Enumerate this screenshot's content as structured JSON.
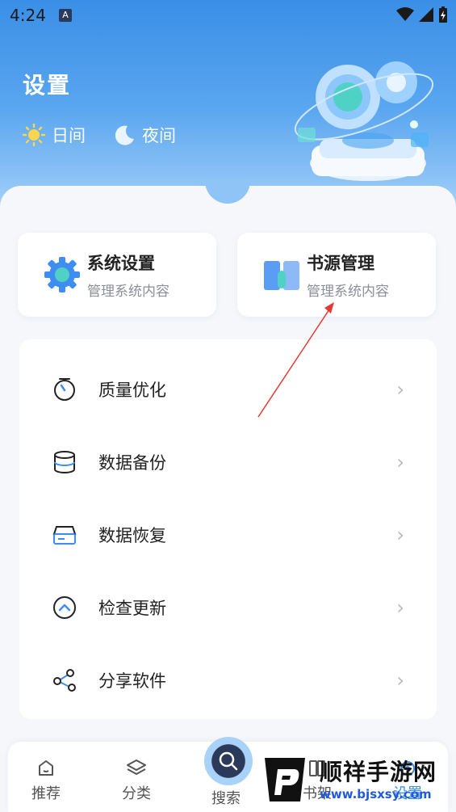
{
  "status_bar": {
    "time": "4:24",
    "badge": "A"
  },
  "header": {
    "title": "设置",
    "day_label": "日间",
    "night_label": "夜间"
  },
  "cards": [
    {
      "title": "系统设置",
      "subtitle": "管理系统内容",
      "icon": "gear-icon"
    },
    {
      "title": "书源管理",
      "subtitle": "管理系统内容",
      "icon": "book-icon"
    }
  ],
  "menu": [
    {
      "label": "质量优化",
      "icon": "timer-icon"
    },
    {
      "label": "数据备份",
      "icon": "database-icon"
    },
    {
      "label": "数据恢复",
      "icon": "server-icon"
    },
    {
      "label": "检查更新",
      "icon": "update-icon"
    },
    {
      "label": "分享软件",
      "icon": "share-icon"
    }
  ],
  "tabs": [
    {
      "label": "推荐",
      "icon": "home-icon"
    },
    {
      "label": "分类",
      "icon": "layers-icon"
    },
    {
      "label": "搜索",
      "icon": "search-icon"
    },
    {
      "label": "书架",
      "icon": "shelf-icon"
    },
    {
      "label": "设置",
      "icon": "settings-icon"
    }
  ],
  "watermark": {
    "title": "顺祥手游网",
    "url": "www.bjsxsy.com"
  },
  "colors": {
    "accent": "#3a8fe6",
    "hero_light": "#cfe4fb",
    "annotation": "#e53935"
  }
}
